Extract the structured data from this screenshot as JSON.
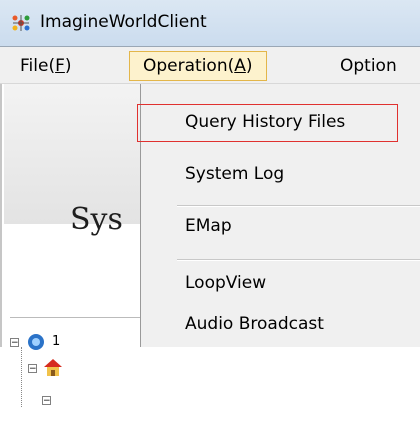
{
  "window": {
    "title": "ImagineWorldClient",
    "icon": "app-icon"
  },
  "menubar": {
    "file": {
      "label": "File(",
      "accel": "F",
      "close": ")"
    },
    "operation": {
      "label": "Operation(",
      "accel": "A",
      "close": ")"
    },
    "options": {
      "label": "Option"
    }
  },
  "left_panel": {
    "banner_text": "Sys",
    "tree": [
      {
        "label": "1",
        "icon": "network-icon"
      },
      {
        "label": "",
        "icon": "house-icon"
      }
    ]
  },
  "dropdown": {
    "items": [
      {
        "label": "Query History Files",
        "highlighted": true
      },
      {
        "label": "System Log"
      },
      {
        "label": "EMap"
      },
      {
        "label": "LoopView"
      },
      {
        "label": "Audio Broadcast"
      }
    ]
  },
  "colors": {
    "highlight_border": "#e0312f",
    "menu_active_bg": "#fdf2cd",
    "menu_active_border": "#e3b64a"
  }
}
